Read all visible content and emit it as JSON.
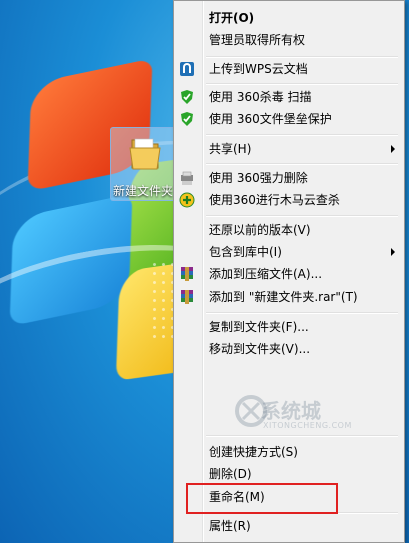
{
  "desktop": {
    "folder_label": "新建文件夹"
  },
  "menu": {
    "items": [
      {
        "label": "打开(O)",
        "icon": "none"
      },
      {
        "label": "管理员取得所有权",
        "icon": "none"
      },
      {
        "label": "上传到WPS云文档",
        "icon": "wps-cloud-icon"
      },
      {
        "label": "使用 360杀毒 扫描",
        "icon": "360-shield-icon"
      },
      {
        "label": "使用 360文件堡垒保护",
        "icon": "360-shield-icon"
      },
      {
        "label": "共享(H)",
        "icon": "none"
      },
      {
        "label": "使用 360强力删除",
        "icon": "shredder-icon"
      },
      {
        "label": "使用360进行木马云查杀",
        "icon": "360-plus-icon"
      },
      {
        "label": "还原以前的版本(V)",
        "icon": "none"
      },
      {
        "label": "包含到库中(I)",
        "icon": "none"
      },
      {
        "label": "添加到压缩文件(A)...",
        "icon": "winrar-icon"
      },
      {
        "label": "添加到 \"新建文件夹.rar\"(T)",
        "icon": "winrar-icon"
      },
      {
        "label": "复制到文件夹(F)...",
        "icon": "none"
      },
      {
        "label": "移动到文件夹(V)...",
        "icon": "none"
      },
      {
        "label": "创建快捷方式(S)",
        "icon": "none"
      },
      {
        "label": "删除(D)",
        "icon": "none"
      },
      {
        "label": "重命名(M)",
        "icon": "none"
      },
      {
        "label": "属性(R)",
        "icon": "none"
      }
    ]
  },
  "watermark": {
    "text": "系统城",
    "sub": "XITONGCHENG.COM"
  },
  "colors": {
    "highlight_box": "#e02020",
    "menu_bg": "#f0f0f0"
  }
}
